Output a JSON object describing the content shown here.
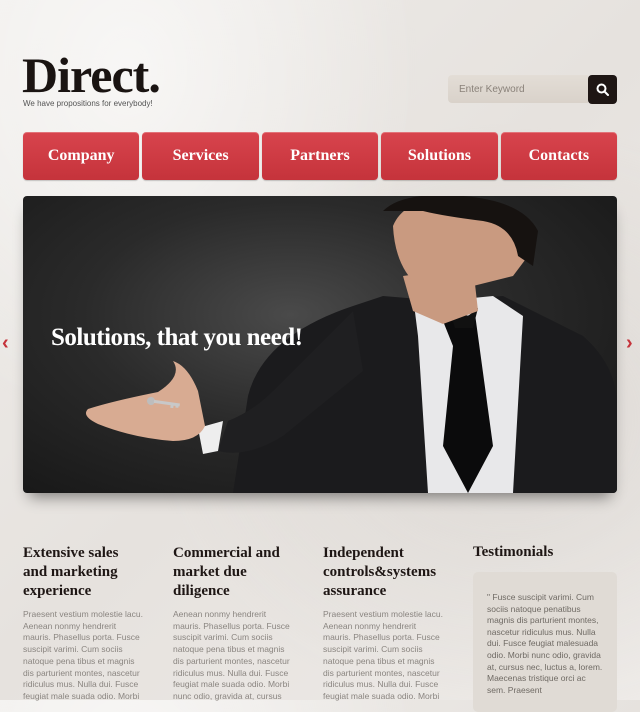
{
  "header": {
    "logo": "Direct.",
    "tagline": "We have propositions for everybody!",
    "search_placeholder": "Enter Keyword"
  },
  "nav": {
    "items": [
      {
        "label": "Company"
      },
      {
        "label": "Services"
      },
      {
        "label": "Partners"
      },
      {
        "label": "Solutions"
      },
      {
        "label": "Contacts"
      }
    ]
  },
  "slider": {
    "caption": "Solutions, that you need!",
    "prev_arrow": "‹",
    "next_arrow": "›"
  },
  "columns": [
    {
      "title": "Extensive sales and marketing experience",
      "text": "Praesent vestium molestie lacu. Aenean nonmy hendrerit mauris. Phasellus porta. Fusce suscipit varimi. Cum sociis natoque pena tibus et magnis dis parturient montes, nascetur ridiculus mus. Nulla dui. Fusce feugiat male suada odio. Morbi"
    },
    {
      "title": "Commercial and market due diligence",
      "text": "Aenean nonmy hendrerit mauris. Phasellus porta. Fusce suscipit varimi. Cum sociis natoque pena tibus et magnis dis parturient montes, nascetur ridiculus mus. Nulla dui. Fusce feugiat male suada odio. Morbi nunc odio, gravida at, cursus"
    },
    {
      "title": "Independent controls&systems assurance",
      "text": "Praesent vestium molestie lacu. Aenean nonmy hendrerit mauris. Phasellus porta. Fusce suscipit varimi. Cum sociis natoque pena tibus et magnis dis parturient montes, nascetur ridiculus mus. Nulla dui. Fusce feugiat male suada odio. Morbi"
    }
  ],
  "testimonials": {
    "title": "Testimonials",
    "quote": "\" Fusce suscipit varimi. Cum sociis natoque penatibus magnis dis parturient montes, nascetur ridiculus mus. Nulla dui. Fusce feugiat malesuada odio. Morbi nunc odio, gravida at, cursus nec, luctus a, lorem. Maecenas tristique orci ac sem. Praesent"
  },
  "colors": {
    "accent": "#c5333b",
    "dark": "#1e1614",
    "background": "#ece9e6"
  }
}
